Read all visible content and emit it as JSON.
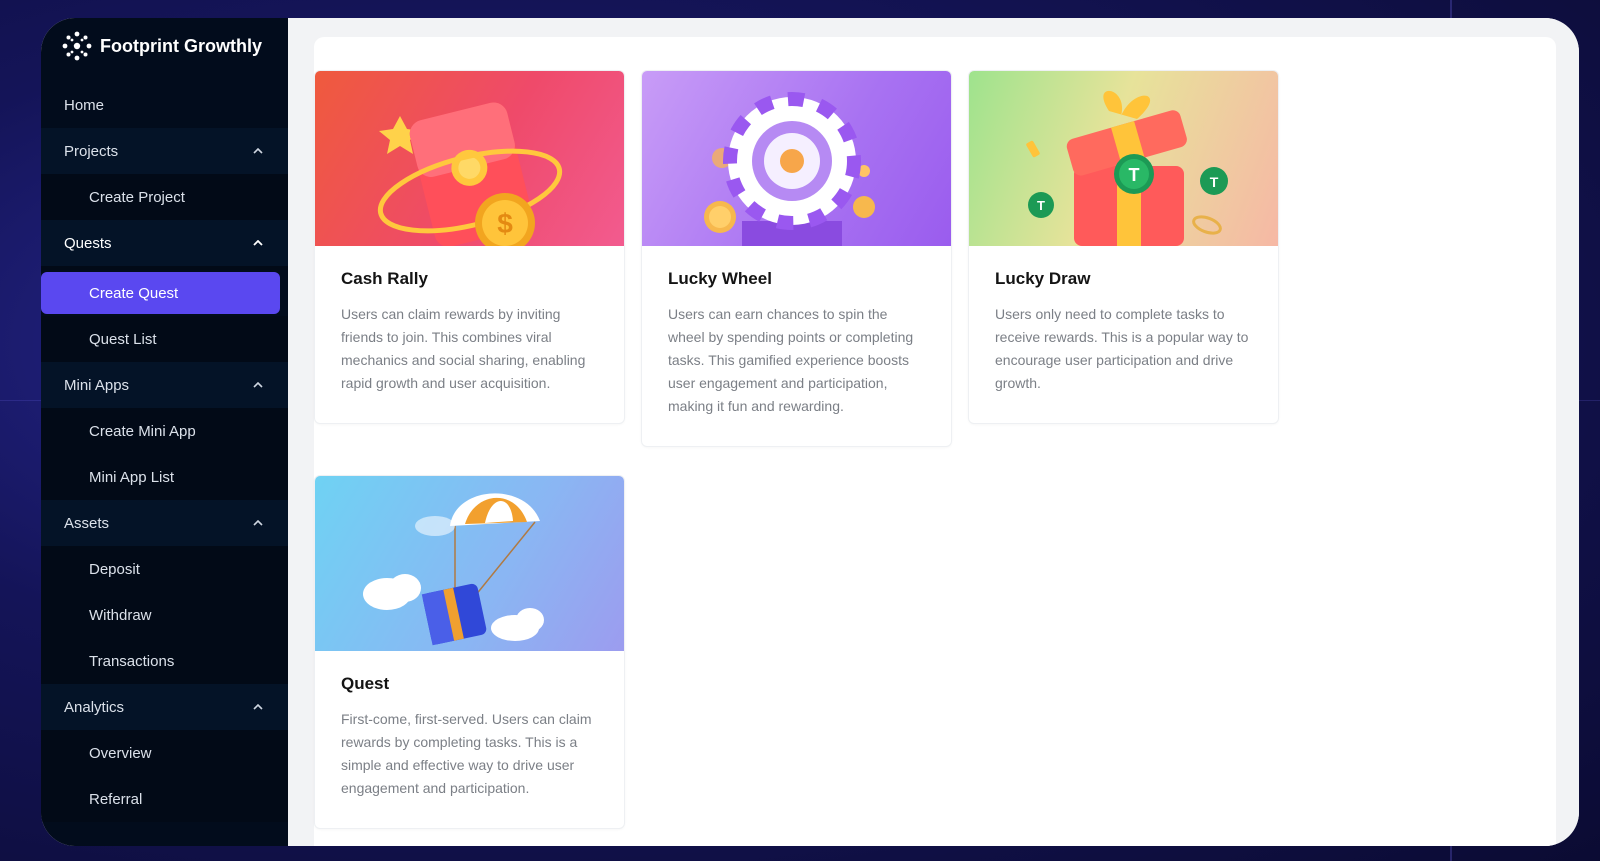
{
  "brand": {
    "name": "Footprint Growthly"
  },
  "sidebar": {
    "home": "Home",
    "groups": [
      {
        "label": "Projects",
        "items": [
          "Create Project"
        ]
      },
      {
        "label": "Quests",
        "items": [
          "Create Quest",
          "Quest List"
        ]
      },
      {
        "label": "Mini Apps",
        "items": [
          "Create Mini App",
          "Mini App List"
        ]
      },
      {
        "label": "Assets",
        "items": [
          "Deposit",
          "Withdraw",
          "Transactions"
        ]
      },
      {
        "label": "Analytics",
        "items": [
          "Overview",
          "Referral"
        ]
      }
    ],
    "selected_item": "Create Quest",
    "accent_color": "#5a48f0"
  },
  "cards": [
    {
      "title": "Cash Rally",
      "description": "Users can claim rewards by inviting friends to join. This combines viral mechanics and social sharing, enabling rapid growth and user acquisition."
    },
    {
      "title": "Lucky Wheel",
      "description": "Users can earn chances to spin the wheel by spending points or completing tasks. This gamified experience boosts user engagement and participation, making it fun and rewarding."
    },
    {
      "title": "Lucky Draw",
      "description": "Users only need to complete tasks to receive rewards. This is a popular way to encourage user participation and drive growth."
    },
    {
      "title": "Quest",
      "description": "First-come, first-served. Users can claim rewards by completing tasks. This is a simple and effective way to drive user engagement and participation."
    }
  ]
}
